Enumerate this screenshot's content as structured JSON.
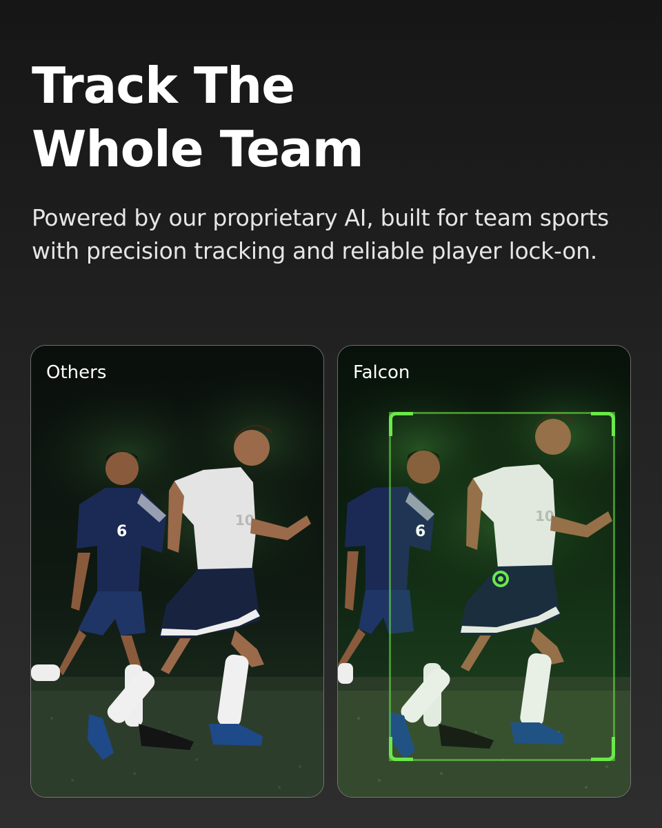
{
  "headline": {
    "line1": "Track The",
    "line2": "Whole Team"
  },
  "subtitle": "Powered by our proprietary AI, built for team sports with precision tracking and reliable player lock-on.",
  "comparison": {
    "left_label": "Others",
    "right_label": "Falcon"
  },
  "players": {
    "dark_kit_number": "6",
    "light_kit_number": "10"
  },
  "colors": {
    "background": "#1c1c1c",
    "tracking_accent": "#6ce84a",
    "dark_kit": "#16234a",
    "light_kit": "#e6e6e6"
  }
}
